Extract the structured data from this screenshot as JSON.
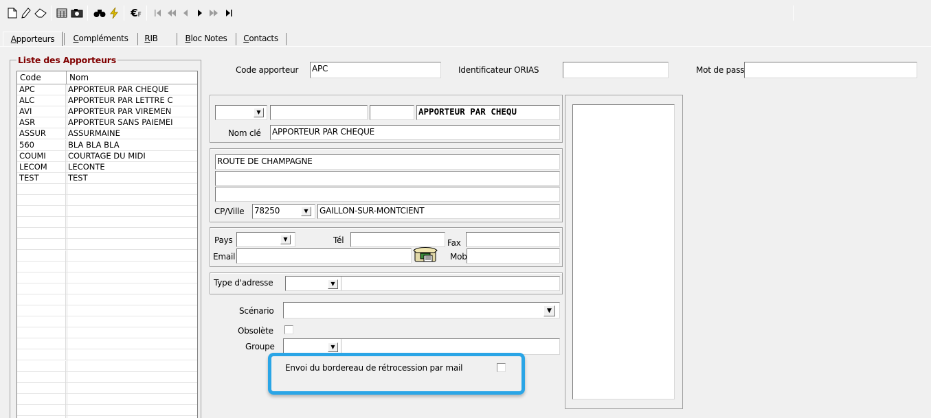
{
  "toolbar": {
    "buttons": [
      {
        "name": "new-icon",
        "glyph": "🗋"
      },
      {
        "name": "edit-icon",
        "glyph": "✎"
      },
      {
        "name": "eraser-icon",
        "glyph": "⌫"
      },
      {
        "name": "table-icon",
        "glyph": "▦"
      },
      {
        "name": "camera-icon",
        "glyph": "📷"
      },
      {
        "name": "binoculars-icon",
        "glyph": "⛶"
      },
      {
        "name": "lightning-icon",
        "glyph": "⚡"
      },
      {
        "name": "euro-icon",
        "glyph": "€F"
      },
      {
        "name": "first-record-icon",
        "glyph": "|◀"
      },
      {
        "name": "rewind-icon",
        "glyph": "◀◀"
      },
      {
        "name": "previous-record-icon",
        "glyph": "◀"
      },
      {
        "name": "next-record-icon",
        "glyph": "▶"
      },
      {
        "name": "fast-forward-icon",
        "glyph": "▶▶"
      },
      {
        "name": "last-record-icon",
        "glyph": "▶|"
      }
    ]
  },
  "tabs": [
    {
      "pre": "",
      "u": "A",
      "post": "pporteurs"
    },
    {
      "pre": "",
      "u": "C",
      "post": "ompléments"
    },
    {
      "pre": "",
      "u": "R",
      "post": "IB"
    },
    {
      "pre": "",
      "u": "B",
      "post": "loc Notes"
    },
    {
      "pre": "",
      "u": "C",
      "post": "ontacts"
    }
  ],
  "list": {
    "title": "Liste des Apporteurs",
    "columns": [
      "Code",
      "Nom"
    ],
    "rows": [
      [
        "APC",
        "APPORTEUR PAR CHEQUE"
      ],
      [
        "ALC",
        "APPORTEUR PAR LETTRE C"
      ],
      [
        "AVI",
        "APPORTEUR PAR VIREMEN"
      ],
      [
        "ASR",
        "APPORTEUR SANS PAIEMEI"
      ],
      [
        "ASSUR",
        "ASSURMAINE"
      ],
      [
        "560",
        "BLA BLA BLA"
      ],
      [
        "COUMI",
        "COURTAGE DU MIDI"
      ],
      [
        "LECOM",
        "LECONTE"
      ],
      [
        "TEST",
        "TEST"
      ]
    ]
  },
  "form": {
    "code_label": "Code apporteur",
    "code_value": "APC",
    "orias_label": "Identificateur ORIAS",
    "orias_value": "",
    "password_label": "Mot de passe",
    "password_value": "",
    "name_display": "APPORTEUR PAR CHEQU",
    "nomcle_label": "Nom clé",
    "nomcle_value": "APPORTEUR PAR CHEQUE",
    "address1": "ROUTE DE CHAMPAGNE",
    "address2": "",
    "address3": "",
    "cpville_label": "CP/Ville",
    "cp_value": "78250",
    "ville_value": "GAILLON-SUR-MONTCIENT",
    "pays_label": "Pays",
    "tel_label": "Tél",
    "fax_label": "Fax",
    "email_label": "Email",
    "mob_label": "Mob",
    "type_adresse_label": "Type d'adresse",
    "scenario_label": "Scénario",
    "obsolete_label": "Obsolète",
    "groupe_label": "Groupe",
    "envoi_label": "Envoi du bordereau de rétrocession par mail"
  },
  "colors": {
    "highlight": "#2aa5e6",
    "list_title": "#800000"
  }
}
